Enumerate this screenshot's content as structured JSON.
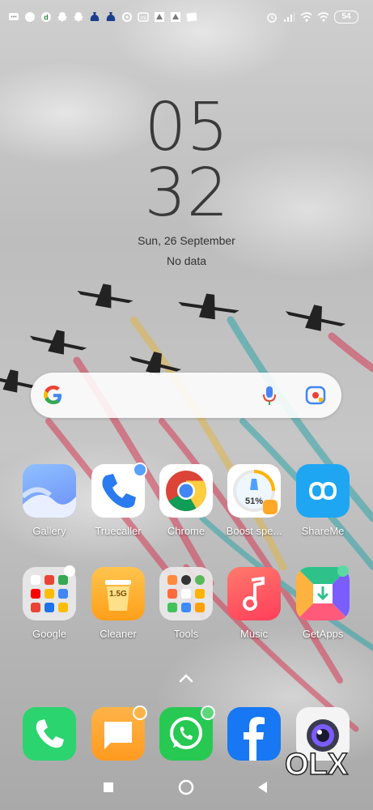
{
  "status_bar": {
    "left_icons": [
      "message-icon",
      "chat-bubble-icon",
      "dream11-icon",
      "snapchat-icon",
      "snapchat-icon",
      "moneybag-icon",
      "moneybag-icon",
      "sync-icon",
      "mi-icon",
      "grid-icon",
      "grid-icon",
      "news-icon"
    ],
    "right_icons": [
      "alarm-icon",
      "signal-icon",
      "wifi-icon",
      "wifi-icon"
    ],
    "battery": "54"
  },
  "clock": {
    "hour": "05",
    "minute": "32"
  },
  "date": "Sun, 26 September",
  "weather": "No data",
  "search": {
    "google_icon": "google-g-icon",
    "mic_icon": "mic-icon",
    "lens_icon": "camera-lens-icon"
  },
  "apps_row1": [
    {
      "label": "Gallery",
      "color": "#7fb0ff"
    },
    {
      "label": "Truecaller",
      "color": "#ffffff"
    },
    {
      "label": "Chrome",
      "color": "#ffffff"
    },
    {
      "label": "Boost spe...",
      "color": "#ffffff",
      "percent": "51%"
    },
    {
      "label": "ShareMe",
      "color": "#2aa7f5"
    }
  ],
  "apps_row2": [
    {
      "label": "Google",
      "color": "#e9e9e9"
    },
    {
      "label": "Cleaner",
      "color": "#ffb02e",
      "size": "1.5G"
    },
    {
      "label": "Tools",
      "color": "#e9e9e9"
    },
    {
      "label": "Music",
      "color": "#ff5a5f"
    },
    {
      "label": "GetApps",
      "color": "#ffffff"
    }
  ],
  "dock": [
    {
      "name": "phone",
      "color": "#2bd46e"
    },
    {
      "name": "messages",
      "color": "#ffa02a"
    },
    {
      "name": "whatsapp",
      "color": "#27c953"
    },
    {
      "name": "facebook",
      "color": "#1877f2"
    },
    {
      "name": "camera",
      "color": "#ffffff"
    }
  ],
  "watermark": "OLX"
}
